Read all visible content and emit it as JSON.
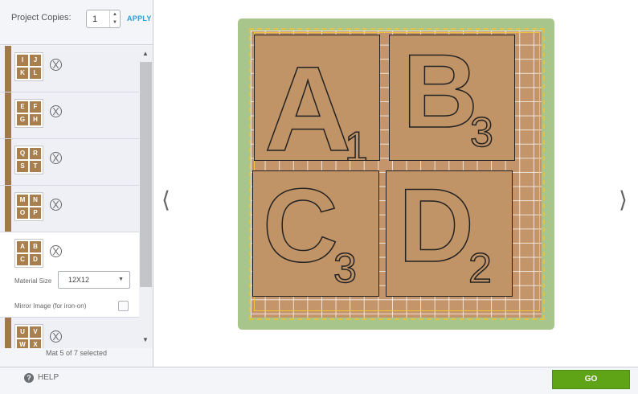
{
  "copies": {
    "label": "Project Copies:",
    "value": "1",
    "apply_label": "APPLY"
  },
  "mats": [
    {
      "tiles": [
        "I",
        "J",
        "K",
        "L"
      ],
      "selected": false
    },
    {
      "tiles": [
        "E",
        "F",
        "G",
        "H"
      ],
      "selected": false
    },
    {
      "tiles": [
        "Q",
        "R",
        "S",
        "T"
      ],
      "selected": false
    },
    {
      "tiles": [
        "M",
        "N",
        "O",
        "P"
      ],
      "selected": false
    },
    {
      "tiles": [
        "A",
        "B",
        "C",
        "D"
      ],
      "selected": true
    },
    {
      "tiles": [
        "U",
        "V",
        "W",
        "X"
      ],
      "selected": false
    }
  ],
  "material": {
    "label": "Material Size",
    "value": "12X12"
  },
  "mirror": {
    "label": "Mirror Image (for iron-on)",
    "checked": false
  },
  "status": "Mat 5 of 7 selected",
  "canvas": {
    "tiles": [
      {
        "letter": "A",
        "sub": "1"
      },
      {
        "letter": "B",
        "sub": "3"
      },
      {
        "letter": "C",
        "sub": "3"
      },
      {
        "letter": "D",
        "sub": "2"
      }
    ]
  },
  "footer": {
    "help_label": "HELP",
    "go_label": "GO"
  },
  "colors": {
    "accent": "#5ea416",
    "mat_green": "#a8c58c",
    "tile_brown": "#c19468",
    "apply_blue": "#2f9bd8"
  }
}
